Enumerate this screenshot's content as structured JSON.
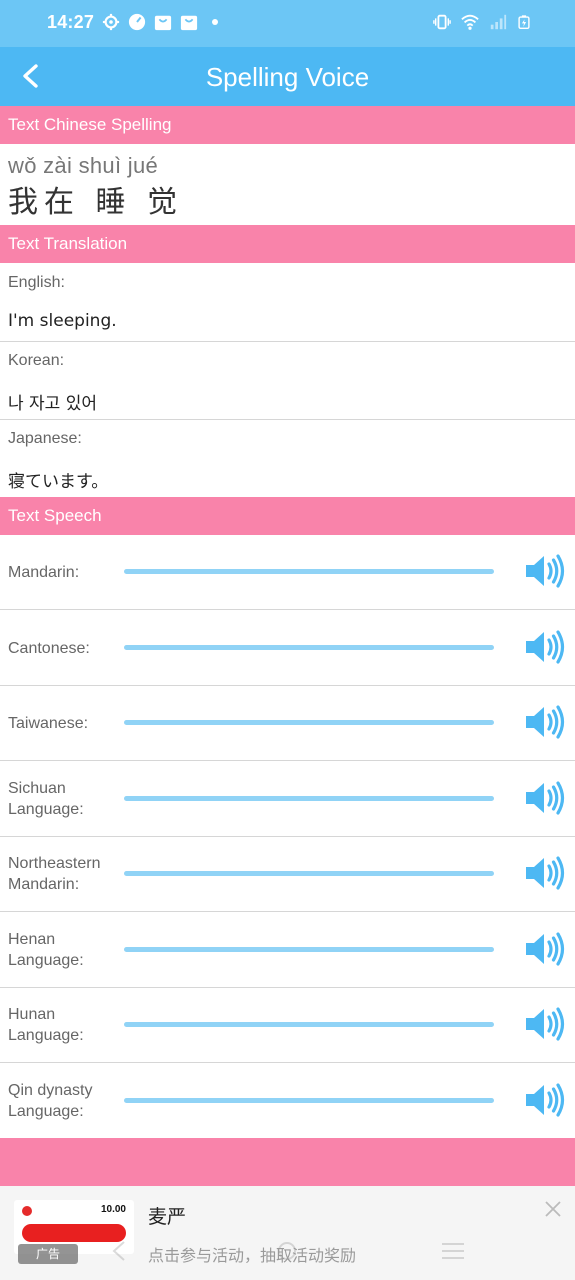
{
  "status_bar": {
    "time": "14:27",
    "icons": [
      "settings-icon",
      "clock-icon",
      "shopping-bag-icon",
      "shopping-bag-icon",
      "dot-icon"
    ],
    "right_icons": [
      "vibrate-icon",
      "wifi-icon",
      "signal-icon",
      "battery-charging-icon"
    ]
  },
  "app_bar": {
    "back_icon": "chevron-left-icon",
    "title": "Spelling Voice"
  },
  "spelling_section": {
    "header": "Text Chinese Spelling",
    "pinyin": "wǒ zài shuì jué",
    "hanzi": "我在 睡 觉"
  },
  "translation_section": {
    "header": "Text Translation",
    "rows": [
      {
        "label": "English:",
        "value": "I'm sleeping."
      },
      {
        "label": "Korean:",
        "value": "나 자고 있어"
      },
      {
        "label": "Japanese:",
        "value": "寝ています。"
      }
    ]
  },
  "speech_section": {
    "header": "Text Speech",
    "speaker_icon": "speaker-icon",
    "rows": [
      {
        "label": "Mandarin:"
      },
      {
        "label": "Cantonese:"
      },
      {
        "label": "Taiwanese:"
      },
      {
        "label": "Sichuan Language:"
      },
      {
        "label": "Northeastern Mandarin:"
      },
      {
        "label": "Henan Language:"
      },
      {
        "label": "Hunan Language:"
      },
      {
        "label": "Qin dynasty Language:"
      }
    ]
  },
  "ad": {
    "label": "广告",
    "title": "麦严",
    "subtitle": "点击参与活动，抽取活动奖励",
    "thumb_price": "10.00",
    "close_icon": "close-icon"
  },
  "colors": {
    "status_bar": "#6cc6f5",
    "app_bar": "#4db8f3",
    "section_header": "#f983aa",
    "slider": "#90d3f6",
    "speaker": "#4db8f3"
  }
}
